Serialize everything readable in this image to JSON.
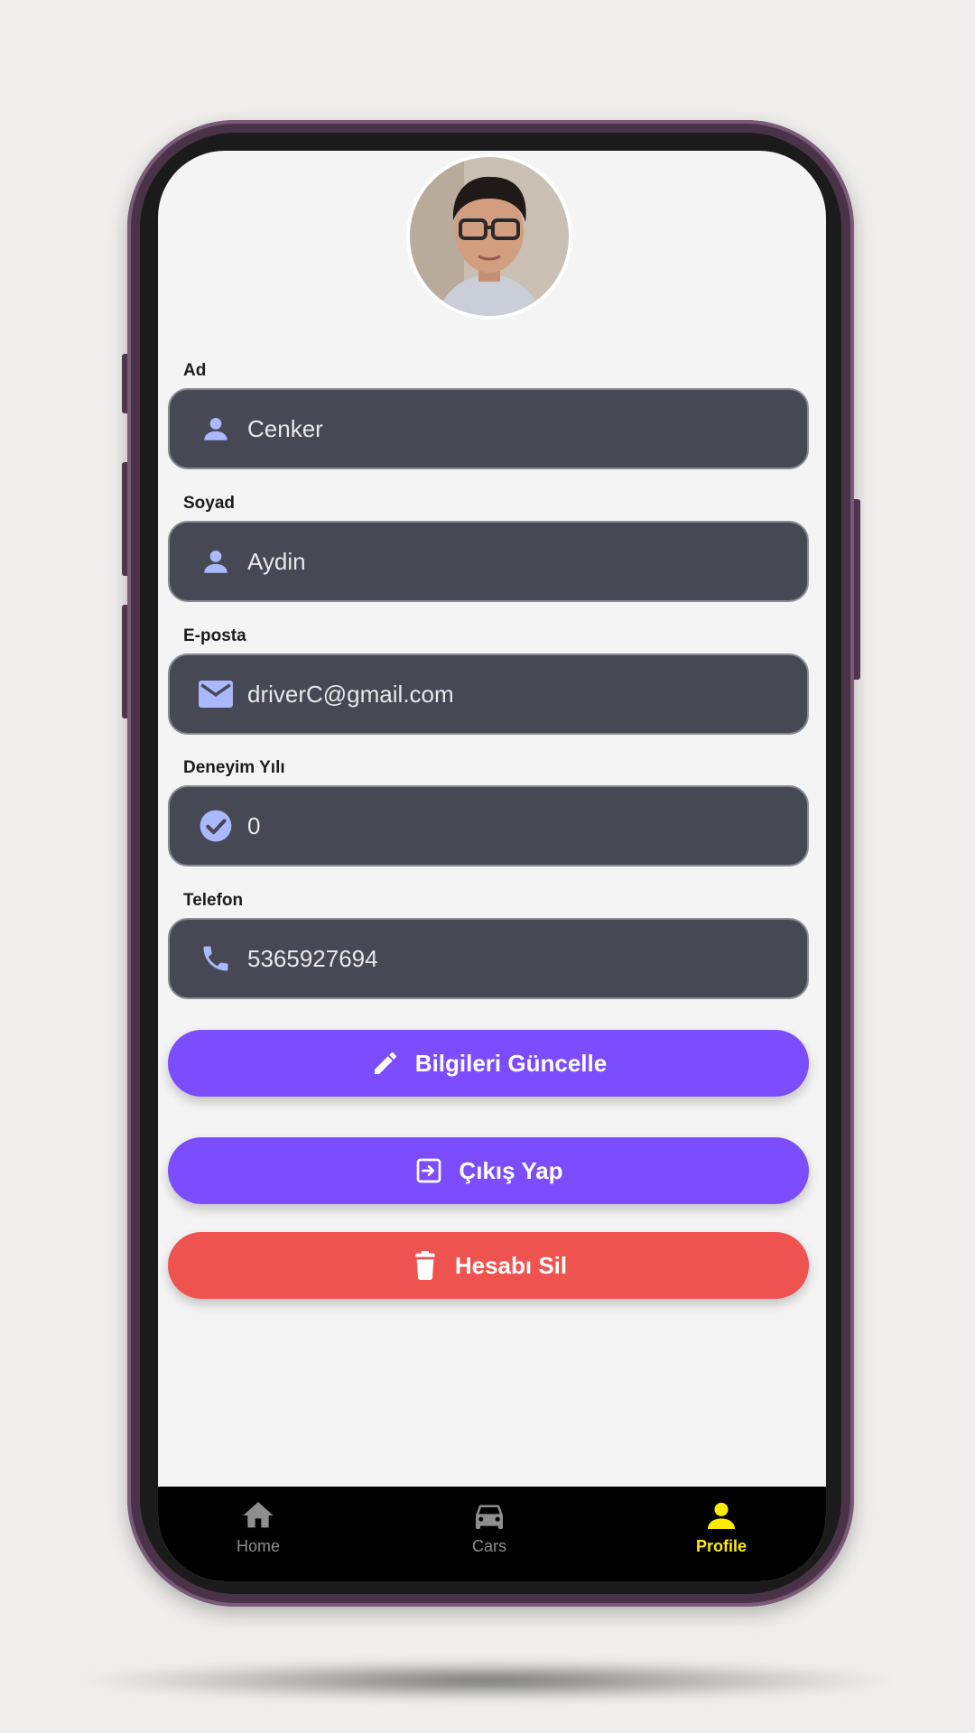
{
  "profile": {
    "fields": [
      {
        "label": "Ad",
        "value": "Cenker",
        "icon": "person-icon"
      },
      {
        "label": "Soyad",
        "value": "Aydin",
        "icon": "person-icon"
      },
      {
        "label": "E-posta",
        "value": "driverC@gmail.com",
        "icon": "email-icon"
      },
      {
        "label": "Deneyim Yılı",
        "value": "0",
        "icon": "check-circle-icon"
      },
      {
        "label": "Telefon",
        "value": "5365927694",
        "icon": "phone-icon"
      }
    ]
  },
  "actions": {
    "update_label": "Bilgileri Güncelle",
    "logout_label": "Çıkış Yap",
    "delete_label": "Hesabı Sil"
  },
  "tabs": [
    {
      "label": "Home",
      "icon": "home-icon",
      "active": false
    },
    {
      "label": "Cars",
      "icon": "car-icon",
      "active": false
    },
    {
      "label": "Profile",
      "icon": "person-icon",
      "active": true
    }
  ],
  "colors": {
    "accent": "#7c4dff",
    "danger": "#ef5350",
    "field_bg": "#464853",
    "field_icon": "#a9b8ff",
    "tab_active": "#ffeb00",
    "tab_inactive": "#8e8e8e"
  }
}
